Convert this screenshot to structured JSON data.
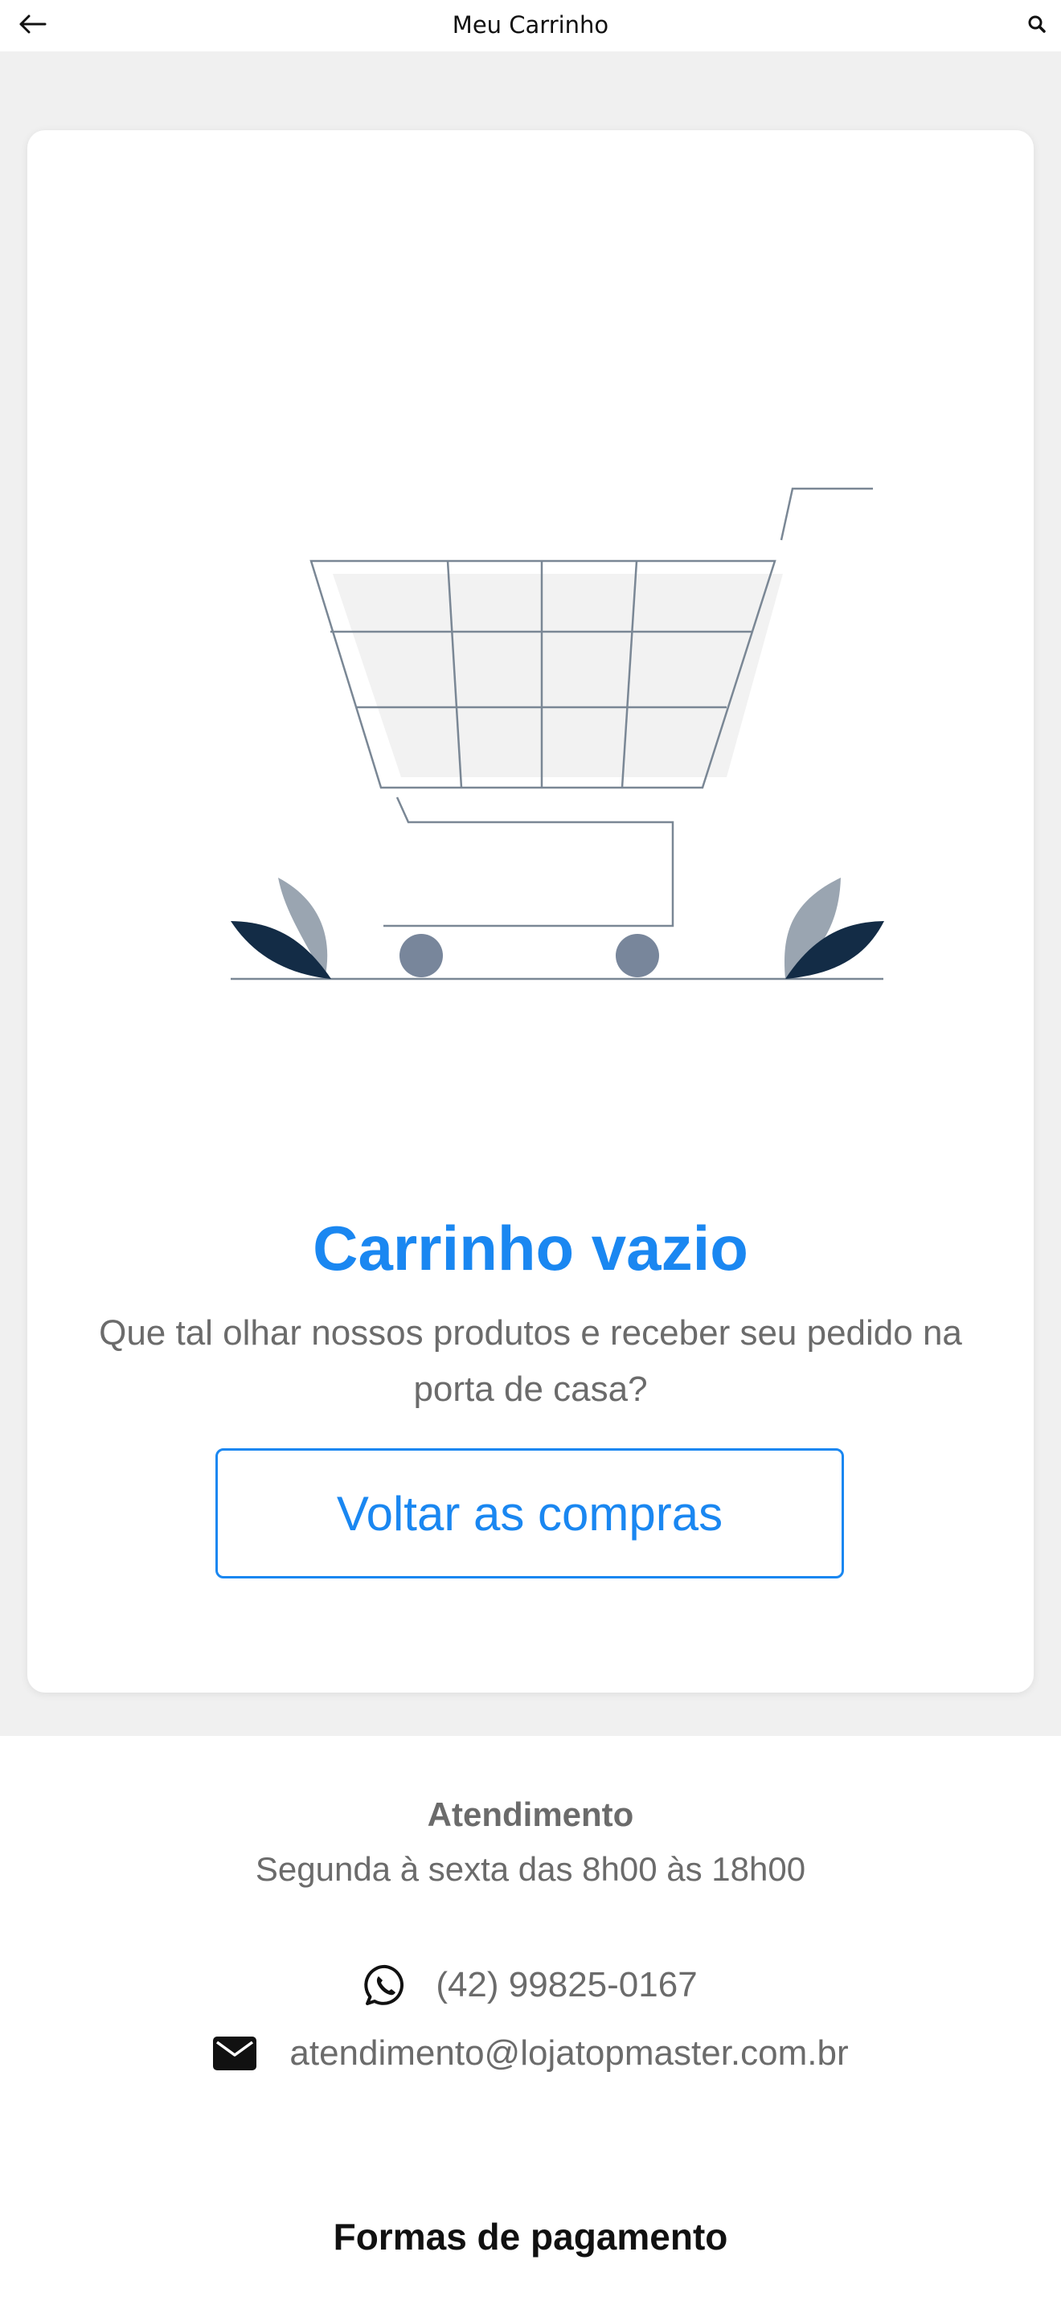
{
  "header": {
    "title": "Meu Carrinho",
    "back_icon": "arrow-left-icon",
    "search_icon": "search-icon"
  },
  "empty_state": {
    "illustration": "shopping-cart-illustration",
    "title": "Carrinho vazio",
    "description": "Que tal olhar nossos produtos e receber seu pedido na porta de casa?",
    "button_label": "Voltar as compras"
  },
  "footer": {
    "support_heading": "Atendimento",
    "support_hours": "Segunda à sexta das 8h00 às 18h00",
    "phone": "(42) 99825-0167",
    "phone_icon": "whatsapp-icon",
    "email": "atendimento@lojatopmaster.com.br",
    "email_icon": "envelope-icon",
    "payments_heading": "Formas de pagamento"
  },
  "colors": {
    "accent": "#1a87f1",
    "muted_text": "#6b6b6b",
    "background_grey": "#f0f0f0",
    "cart_stroke": "#7a8795",
    "leaf_dark": "#132c46",
    "leaf_light": "#9aa5b1"
  }
}
